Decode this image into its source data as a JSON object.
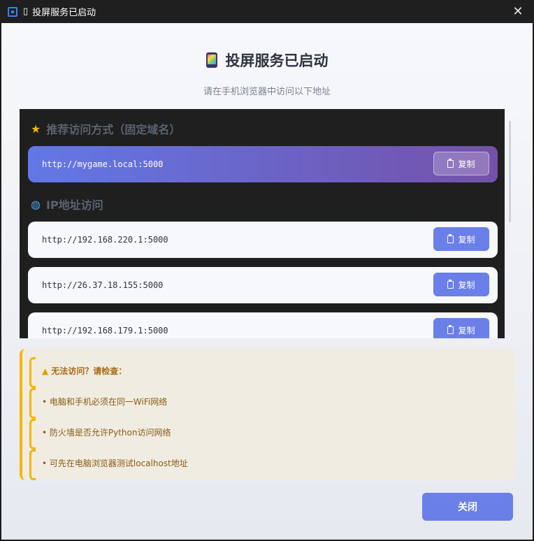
{
  "window": {
    "title": "投屏服务已启动",
    "close_glyph": "✕"
  },
  "header": {
    "icon": "phone-icon",
    "title": "投屏服务已启动",
    "subtitle": "请在手机浏览器中访问以下地址"
  },
  "recommended": {
    "icon": "star-icon",
    "title": "推荐访问方式（固定域名）",
    "url": "http://mygame.local:5000",
    "copy_label": "复制"
  },
  "ip_section": {
    "icon": "globe-icon",
    "title": "IP地址访问",
    "items": [
      {
        "url": "http://192.168.220.1:5000",
        "copy_label": "复制"
      },
      {
        "url": "http://26.37.18.155:5000",
        "copy_label": "复制"
      },
      {
        "url": "http://192.168.179.1:5000",
        "copy_label": "复制"
      }
    ]
  },
  "warning": {
    "icon": "warning-icon",
    "title": "无法访问？请检查：",
    "tips": [
      "• 电脑和手机必须在同一WiFi网络",
      "• 防火墙是否允许Python访问网络",
      "• 可先在电脑浏览器测试localhost地址"
    ]
  },
  "footer": {
    "close_label": "关闭"
  },
  "colors": {
    "accent": "#6a7fe8",
    "featured_start": "#6278e6",
    "featured_end": "#7451a8",
    "warning": "#f5b500"
  }
}
